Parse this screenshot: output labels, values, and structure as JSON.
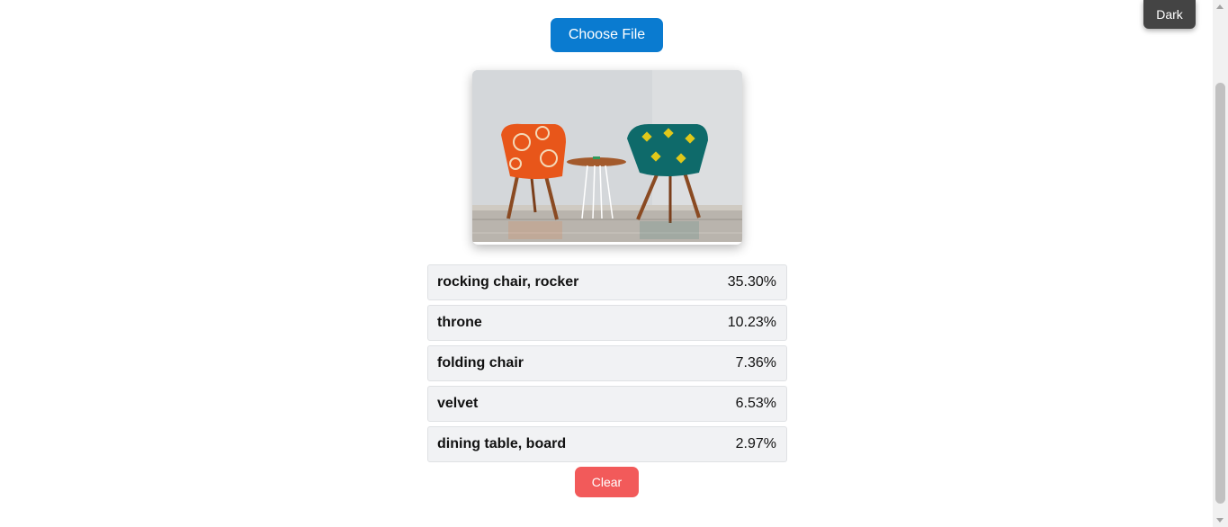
{
  "theme_toggle": {
    "label": "Dark"
  },
  "upload": {
    "choose_file_label": "Choose File"
  },
  "preview": {
    "alt": "uploaded image preview"
  },
  "predictions": [
    {
      "label": "rocking chair, rocker",
      "score": "35.30%"
    },
    {
      "label": "throne",
      "score": "10.23%"
    },
    {
      "label": "folding chair",
      "score": "7.36%"
    },
    {
      "label": "velvet",
      "score": "6.53%"
    },
    {
      "label": "dining table, board",
      "score": "2.97%"
    }
  ],
  "actions": {
    "clear_label": "Clear"
  },
  "colors": {
    "primary": "#0a7bd0",
    "danger": "#f25a5a",
    "toggle": "#444444",
    "row_bg": "#f1f2f4"
  }
}
